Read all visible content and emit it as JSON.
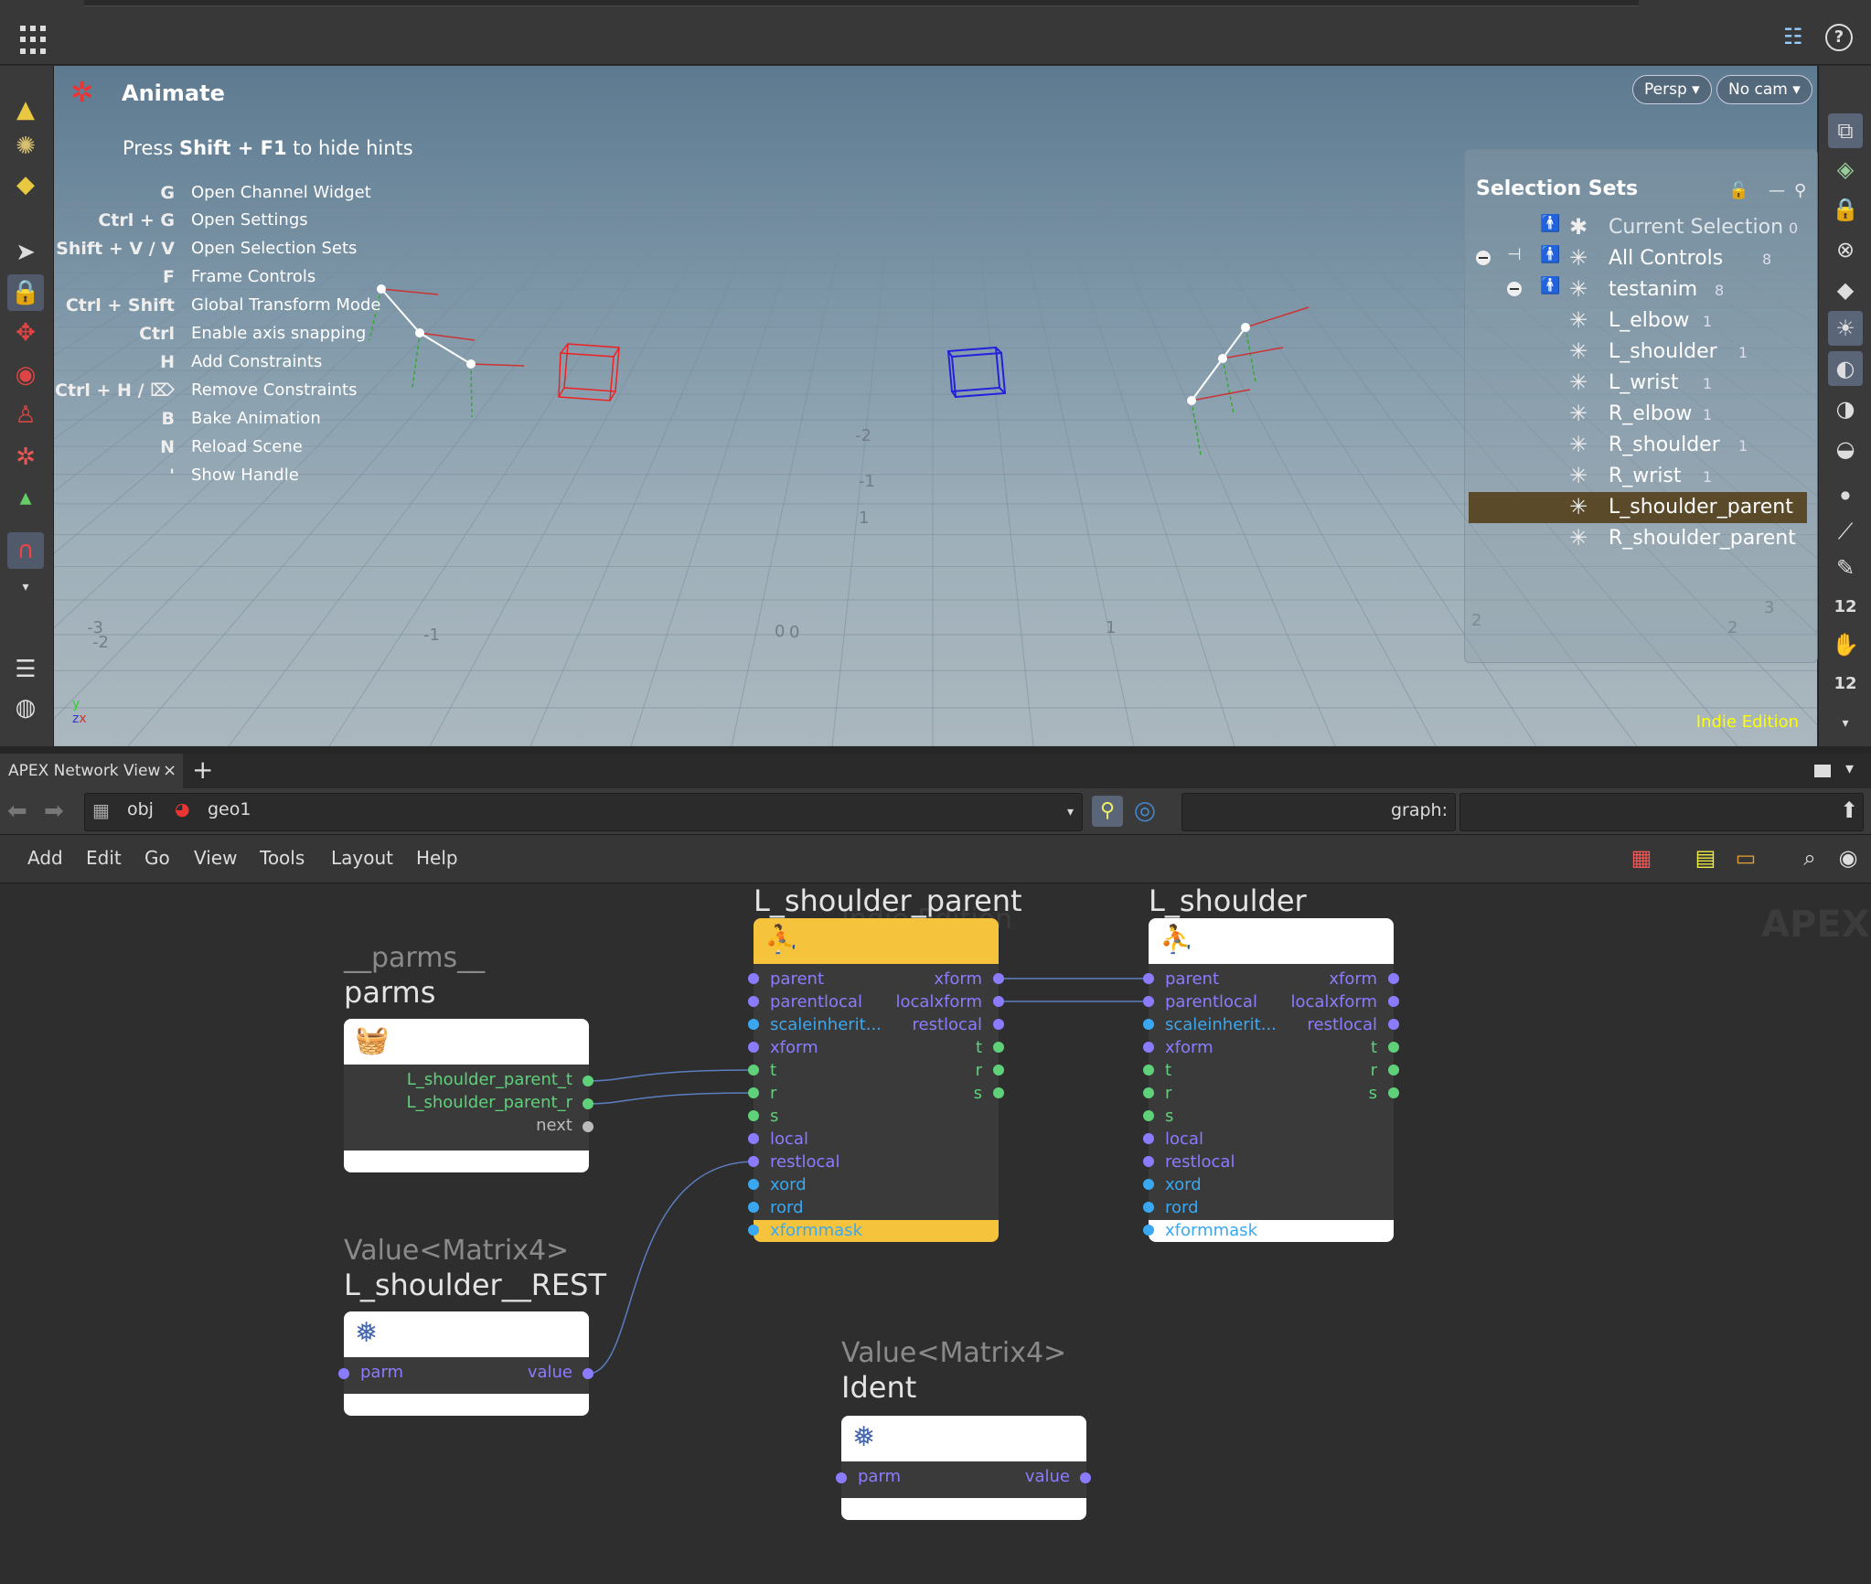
{
  "colors": {
    "accent_yellow": "#f6c43c",
    "port_purple": "#8b7cff",
    "port_blue": "#3aa8f0",
    "port_green": "#5fd17a",
    "selected_row": "#5a4a2a",
    "indie_yellow": "#ffff00"
  },
  "viewport": {
    "title": "Animate",
    "hint_intro_pre": "Press ",
    "hint_intro_keys": "Shift + F1",
    "hint_intro_post": " to hide hints",
    "hints": [
      {
        "key": "G",
        "text": "Open Channel Widget"
      },
      {
        "key": "Ctrl + G",
        "text": "Open Settings"
      },
      {
        "key": "Shift + V / V",
        "text": "Open Selection Sets"
      },
      {
        "key": "F",
        "text": "Frame Controls"
      },
      {
        "key": "Ctrl + Shift",
        "text": "Global Transform Mode"
      },
      {
        "key": "Ctrl",
        "text": "Enable axis snapping"
      },
      {
        "key": "H",
        "text": "Add Constraints"
      },
      {
        "key": "Ctrl + H / ⌦",
        "text": "Remove Constraints"
      },
      {
        "key": "B",
        "text": "Bake Animation"
      },
      {
        "key": "N",
        "text": "Reload Scene"
      },
      {
        "key": "'",
        "text": "Show Handle"
      }
    ],
    "persp_label": "Persp ▾",
    "cam_label": "No cam ▾",
    "indie_label": "Indie Edition",
    "grid_labels": [
      "-2",
      "-1",
      "0",
      "1",
      "2",
      "-3",
      "-2",
      "-1",
      "3",
      "2",
      "1",
      "0"
    ]
  },
  "selection_sets": {
    "title": "Selection Sets",
    "items": [
      {
        "label": "Current Selection",
        "count": "0"
      },
      {
        "label": "All Controls",
        "count": "8"
      },
      {
        "label": "testanim",
        "count": "8"
      },
      {
        "label": "L_elbow",
        "count": "1"
      },
      {
        "label": "L_shoulder",
        "count": "1"
      },
      {
        "label": "L_wrist",
        "count": "1"
      },
      {
        "label": "R_elbow",
        "count": "1"
      },
      {
        "label": "R_shoulder",
        "count": "1"
      },
      {
        "label": "R_wrist",
        "count": "1"
      },
      {
        "label": "L_shoulder_parent",
        "count": ""
      },
      {
        "label": "R_shoulder_parent",
        "count": ""
      }
    ]
  },
  "network_pane": {
    "tab_label": "APEX Network View",
    "tab_close": "×",
    "tab_add": "+",
    "path": {
      "obj": "obj",
      "geo": "geo1"
    },
    "graph_label": "graph:",
    "menu": [
      "Add",
      "Edit",
      "Go",
      "View",
      "Tools",
      "Layout",
      "Help"
    ],
    "watermark": "APEX",
    "indie_watermark": "Indie Edition"
  },
  "nodes": {
    "parms": {
      "type": "__parms__",
      "title": "parms",
      "outputs": [
        "L_shoulder_parent_t",
        "L_shoulder_parent_r",
        "next"
      ]
    },
    "rest": {
      "type": "Value<Matrix4>",
      "title": "L_shoulder__REST",
      "input": "parm",
      "output": "value"
    },
    "ident": {
      "type": "Value<Matrix4>",
      "title": "Ident",
      "input": "parm",
      "output": "value"
    },
    "lsp": {
      "title": "L_shoulder_parent",
      "inputs": [
        "parent",
        "parentlocal",
        "scaleinherit...",
        "xform",
        "t",
        "r",
        "s",
        "local",
        "restlocal",
        "xord",
        "rord",
        "xformmask"
      ],
      "outputs": [
        "xform",
        "localxform",
        "restlocal",
        "t",
        "r",
        "s"
      ]
    },
    "ls": {
      "title": "L_shoulder",
      "inputs": [
        "parent",
        "parentlocal",
        "scaleinherit...",
        "xform",
        "t",
        "r",
        "s",
        "local",
        "restlocal",
        "xord",
        "rord",
        "xformmask"
      ],
      "outputs": [
        "xform",
        "localxform",
        "restlocal",
        "t",
        "r",
        "s"
      ]
    }
  }
}
